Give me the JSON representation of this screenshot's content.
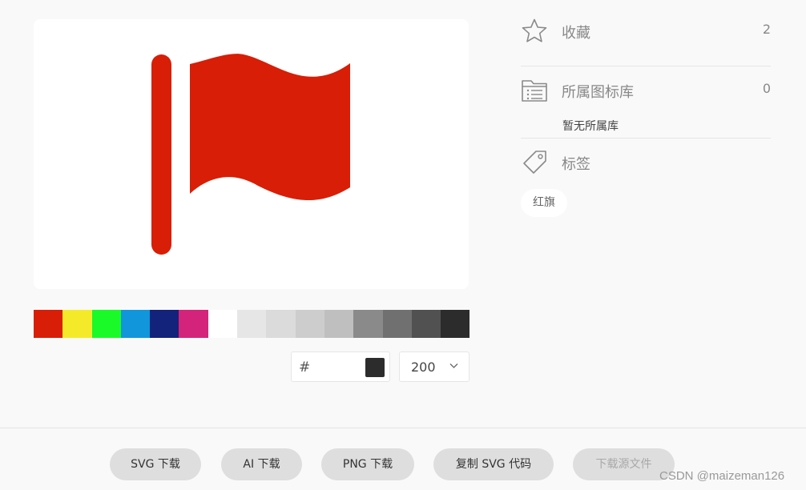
{
  "preview": {
    "icon": "red-flag-icon",
    "icon_color": "#d81e06"
  },
  "palette": {
    "colors": [
      "#d81e06",
      "#f4ea2a",
      "#1afa29",
      "#1296db",
      "#13227a",
      "#d4237a",
      "#ffffff",
      "#e6e6e6",
      "#dbdbdb",
      "#cdcdcd",
      "#bfbfbf",
      "#8a8a8a",
      "#707070",
      "#515151",
      "#2c2c2c"
    ]
  },
  "color_input": {
    "hash": "#",
    "value": "",
    "chip_color": "#2c2c2c"
  },
  "size_select": {
    "value": "200"
  },
  "sidebar": {
    "favorites": {
      "label": "收藏",
      "count": "2",
      "icon": "star-icon"
    },
    "library": {
      "label": "所属图标库",
      "count": "0",
      "icon": "folder-list-icon",
      "empty_text": "暂无所属库"
    },
    "tags": {
      "label": "标签",
      "icon": "tag-icon",
      "items": [
        "红旗"
      ]
    }
  },
  "actions": {
    "svg_download": "SVG 下载",
    "ai_download": "AI 下载",
    "png_download": "PNG 下载",
    "copy_svg": "复制 SVG 代码",
    "download_source": "下载源文件"
  },
  "watermark": "CSDN @maizeman126"
}
